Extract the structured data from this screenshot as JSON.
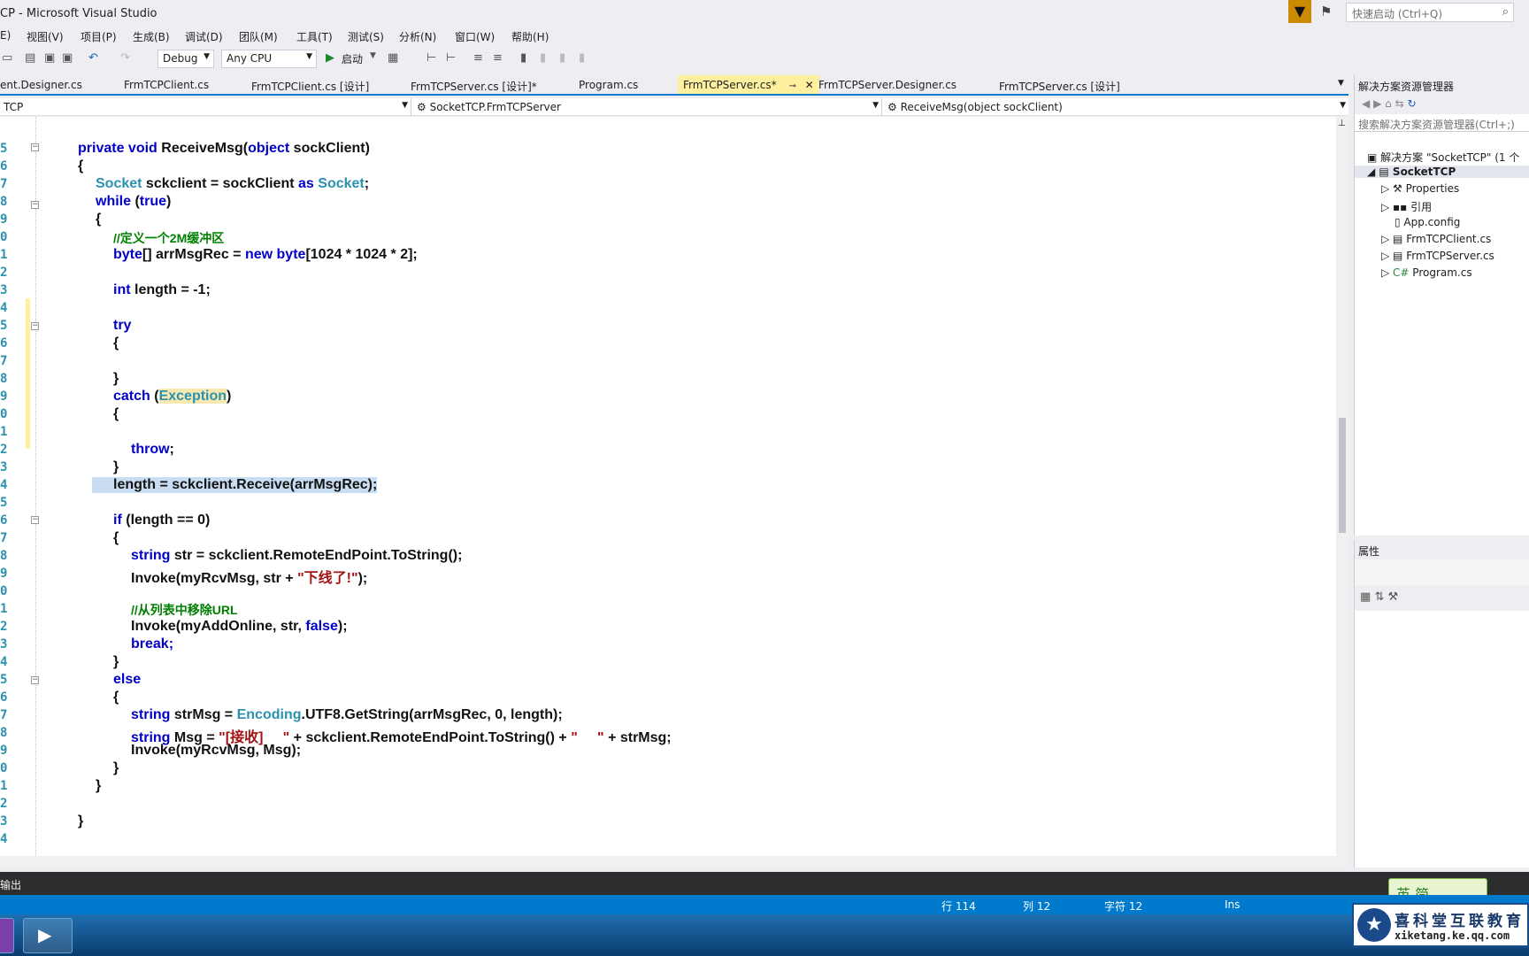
{
  "window": {
    "title": "CP - Microsoft Visual Studio",
    "quick_launch_placeholder": "快速启动 (Ctrl+Q)"
  },
  "menu": [
    "E)",
    "视图(V)",
    "项目(P)",
    "生成(B)",
    "调试(D)",
    "团队(M)",
    "工具(T)",
    "测试(S)",
    "分析(N)",
    "窗口(W)",
    "帮助(H)"
  ],
  "toolbar": {
    "config": "Debug",
    "platform": "Any CPU",
    "start_label": "启动"
  },
  "tabs": [
    {
      "label": "ent.Designer.cs",
      "active": false
    },
    {
      "label": "FrmTCPClient.cs",
      "active": false
    },
    {
      "label": "FrmTCPClient.cs [设计]",
      "active": false
    },
    {
      "label": "FrmTCPServer.cs [设计]*",
      "active": false
    },
    {
      "label": "Program.cs",
      "active": false
    },
    {
      "label": "FrmTCPServer.cs*",
      "active": true
    },
    {
      "label": "FrmTCPServer.Designer.cs",
      "active": false
    },
    {
      "label": "FrmTCPServer.cs [设计]",
      "active": false
    }
  ],
  "nav": {
    "project": "TCP",
    "class": "SocketTCP.FrmTCPServer",
    "member": "ReceiveMsg(object sockClient)"
  },
  "code": {
    "line_numbers": [
      "5",
      "6",
      "7",
      "8",
      "9",
      "0",
      "1",
      "2",
      "3",
      "4",
      "5",
      "6",
      "7",
      "8",
      "9",
      "0",
      "1",
      "2",
      "3",
      "4",
      "5",
      "6",
      "7",
      "8",
      "9",
      "0",
      "1",
      "2",
      "3",
      "4",
      "5",
      "6",
      "7",
      "8",
      "9",
      "0",
      "1",
      "2",
      "3",
      "4"
    ],
    "method_sig": [
      "private",
      "void",
      "ReceiveMsg(",
      "object",
      "sockClient)"
    ],
    "open_brace": "{",
    "close_brace": "}",
    "socket_type": "Socket",
    "socket_decl": "sckclient = sockClient",
    "as_kw": "as",
    "while_kw": "while",
    "true_kw": "true",
    "comment_buffer": "//定义一个2M缓冲区",
    "byte_kw": "byte",
    "byte_decl": "[] arrMsgRec =",
    "new_kw": "new",
    "byte_alloc": "[1024 * 1024 * 2];",
    "int_kw": "int",
    "int_decl": "length = -1;",
    "try_kw": "try",
    "catch_kw": "catch",
    "exception_type": "Exception",
    "throw_kw": "throw",
    "semicolon": ";",
    "receive_line": "length = sckclient.Receive(arrMsgRec);",
    "if_kw": "if",
    "if_cond": "(length == 0)",
    "string_kw": "string",
    "str_decl": "str = sckclient.RemoteEndPoint.ToString();",
    "invoke_offline_a": "Invoke(myRcvMsg, str +",
    "offline_text": "\"下线了!\"",
    "invoke_offline_b": ");",
    "comment_remove": "//从列表中移除URL",
    "invoke_remove_a": "Invoke(myAddOnline, str,",
    "false_kw": "false",
    "invoke_remove_b": ");",
    "break_kw": "break;",
    "else_kw": "else",
    "strmsg_decl": "strMsg =",
    "encoding_type": "Encoding",
    "strmsg_rest": ".UTF8.GetString(arrMsgRec, 0, length);",
    "msg_decl": "Msg =",
    "recv_text": "\"[接收]     \"",
    "msg_mid": "+ sckclient.RemoteEndPoint.ToString() +",
    "gap_text": "\"     \"",
    "msg_end": "+ strMsg;",
    "invoke_msg": "Invoke(myRcvMsg, Msg);"
  },
  "solution_explorer": {
    "title": "解决方案资源管理器",
    "search_placeholder": "搜索解决方案资源管理器(Ctrl+;)",
    "items": [
      {
        "label": "解决方案 \"SocketTCP\" (1 个",
        "icon": "solution-icon"
      },
      {
        "label": "SocketTCP",
        "icon": "csharp-project-icon"
      },
      {
        "label": "Properties",
        "icon": "wrench-icon"
      },
      {
        "label": "引用",
        "icon": "references-icon"
      },
      {
        "label": "App.config",
        "icon": "config-icon"
      },
      {
        "label": "FrmTCPClient.cs",
        "icon": "form-icon"
      },
      {
        "label": "FrmTCPServer.cs",
        "icon": "form-icon"
      },
      {
        "label": "Program.cs",
        "icon": "csharp-file-icon"
      }
    ]
  },
  "properties": {
    "title": "属性"
  },
  "output": {
    "label": "输出"
  },
  "status": {
    "line": "行 114",
    "col": "列 12",
    "char": "字符 12",
    "mode": "Ins"
  },
  "ime": {
    "label": "英 简"
  },
  "brand": {
    "name": "喜科堂互联教育",
    "url": "xiketang.ke.qq.com"
  },
  "colors": {
    "keyword": "#0000c8",
    "type": "#2b91af",
    "comment": "#008000",
    "string": "#a31515",
    "accent": "#007acc"
  }
}
